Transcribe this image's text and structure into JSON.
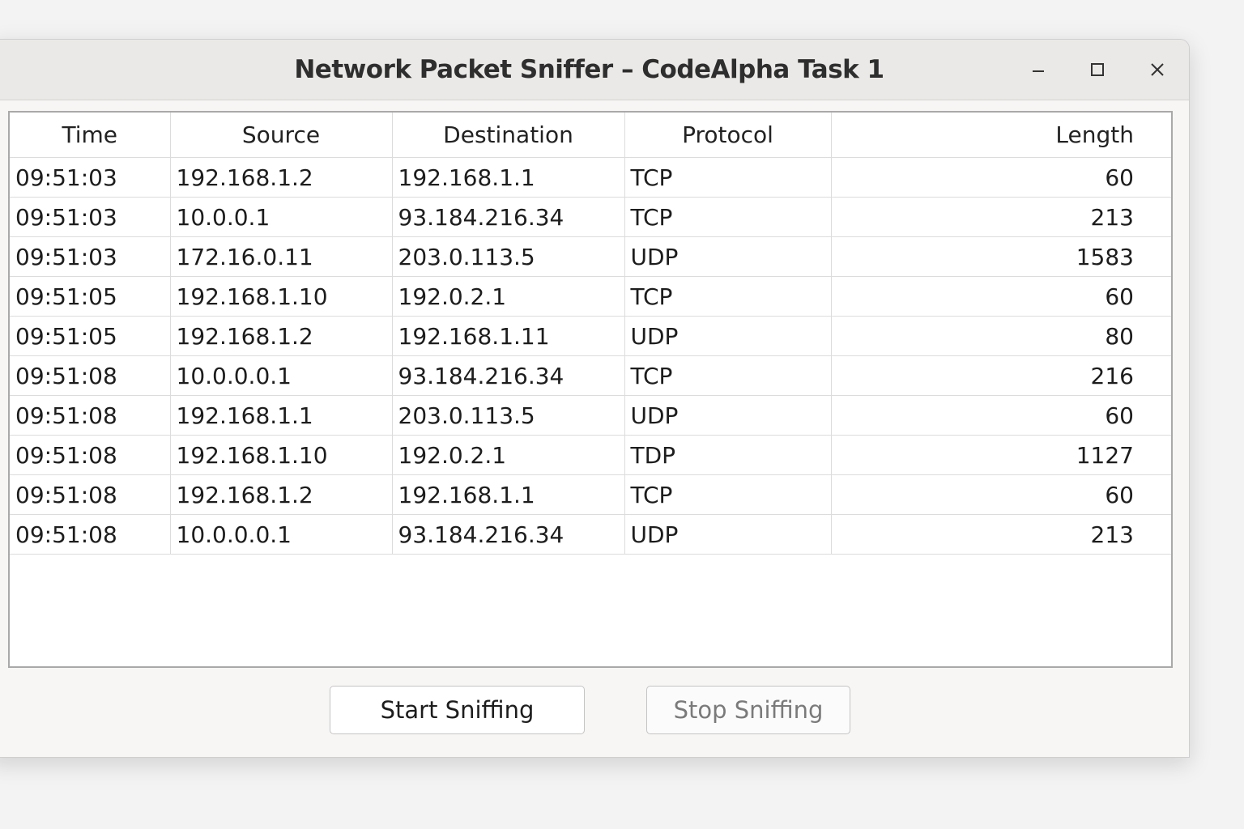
{
  "window": {
    "title": "Network Packet Sniffer – CodeAlpha Task 1"
  },
  "controls": {
    "minimize_icon": "minimize-icon",
    "maximize_icon": "maximize-icon",
    "close_icon": "close-icon"
  },
  "table": {
    "columns": [
      "Time",
      "Source",
      "Destination",
      "Protocol",
      "Length"
    ],
    "rows": [
      [
        "09:51:03",
        "192.168.1.2",
        "192.168.1.1",
        "TCP",
        "60"
      ],
      [
        "09:51:03",
        "10.0.0.1",
        "93.184.216.34",
        "TCP",
        "213"
      ],
      [
        "09:51:03",
        "172.16.0.11",
        "203.0.113.5",
        "UDP",
        "1583"
      ],
      [
        "09:51:05",
        "192.168.1.10",
        "192.0.2.1",
        "TCP",
        "60"
      ],
      [
        "09:51:05",
        "192.168.1.2",
        "192.168.1.11",
        "UDP",
        "80"
      ],
      [
        "09:51:08",
        "10.0.0.0.1",
        "93.184.216.34",
        "TCP",
        "216"
      ],
      [
        "09:51:08",
        "192.168.1.1",
        "203.0.113.5",
        "UDP",
        "60"
      ],
      [
        "09:51:08",
        "192.168.1.10",
        "192.0.2.1",
        "TDP",
        "1127"
      ],
      [
        "09:51:08",
        "192.168.1.2",
        "192.168.1.1",
        "TCP",
        "60"
      ],
      [
        "09:51:08",
        "10.0.0.0.1",
        "93.184.216.34",
        "UDP",
        "213"
      ]
    ]
  },
  "buttons": {
    "start_label": "Start Sniffing",
    "stop_label": "Stop Sniffing"
  }
}
